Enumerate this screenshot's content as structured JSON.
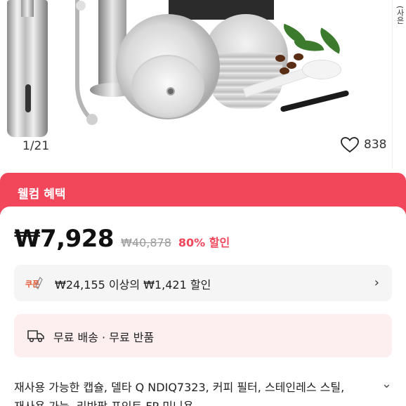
{
  "image": {
    "counter": "1/21",
    "likes": "838",
    "side_text": "(사은"
  },
  "banner": {
    "title": "웰컴 혜택"
  },
  "price": {
    "current": "₩7,928",
    "original": "₩40,878",
    "discount": "80% 할인"
  },
  "coupon": {
    "text": "₩24,155 이상의 ₩1,421 할인",
    "icon_label": "쿠폰"
  },
  "shipping": {
    "text": "무료 배송 · 무료 반품"
  },
  "product": {
    "title_line1": "재사용 가능한 캡슐, 델타 Q NDIQ7323, 커피 필터, 스테인레스 스틸,",
    "title_line2": "재사용 가능, 리반팡 포인트 FP 미니용"
  },
  "colors": {
    "accent": "#f2465b",
    "shipping_bg": "#fdeef0",
    "coupon_bg": "#f5f5f5"
  },
  "icons": [
    "heart-icon",
    "coupon-icon",
    "truck-icon",
    "chevron-right-icon",
    "chevron-down-icon"
  ]
}
